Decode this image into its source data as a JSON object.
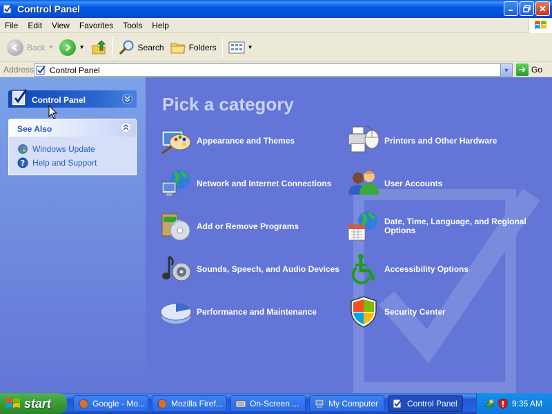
{
  "window": {
    "title": "Control Panel",
    "buttons": [
      "minimize",
      "maximize",
      "close"
    ]
  },
  "menubar": {
    "items": [
      "File",
      "Edit",
      "View",
      "Favorites",
      "Tools",
      "Help"
    ]
  },
  "toolbar": {
    "back_label": "Back",
    "search_label": "Search",
    "folders_label": "Folders"
  },
  "address": {
    "label": "Address",
    "value": "Control Panel",
    "go_label": "Go"
  },
  "leftpane": {
    "panel_title": "Control Panel",
    "see_also_title": "See Also",
    "links": [
      {
        "label": "Windows Update",
        "icon": "windows-update-icon"
      },
      {
        "label": "Help and Support",
        "icon": "help-icon"
      }
    ]
  },
  "main": {
    "heading": "Pick a category",
    "categories": [
      {
        "label": "Appearance and Themes",
        "icon": "appearance-themes-icon"
      },
      {
        "label": "Printers and Other Hardware",
        "icon": "printer-hardware-icon"
      },
      {
        "label": "Network and Internet Connections",
        "icon": "network-icon"
      },
      {
        "label": "User Accounts",
        "icon": "user-accounts-icon"
      },
      {
        "label": "Add or Remove Programs",
        "icon": "add-remove-programs-icon"
      },
      {
        "label": "Date, Time, Language, and Regional Options",
        "icon": "date-time-regional-icon"
      },
      {
        "label": "Sounds, Speech, and Audio Devices",
        "icon": "sounds-audio-icon"
      },
      {
        "label": "Accessibility Options",
        "icon": "accessibility-icon"
      },
      {
        "label": "Performance and Maintenance",
        "icon": "performance-icon"
      },
      {
        "label": "Security Center",
        "icon": "security-center-icon"
      }
    ]
  },
  "taskbar": {
    "start_label": "start",
    "tasks": [
      {
        "label": "Google - Mo...",
        "icon": "firefox-icon"
      },
      {
        "label": "Mozilla Firef...",
        "icon": "firefox-icon"
      },
      {
        "label": "On-Screen ...",
        "icon": "keyboard-icon"
      },
      {
        "label": "My Computer",
        "icon": "my-computer-icon"
      },
      {
        "label": "Control Panel",
        "icon": "control-panel-icon"
      }
    ],
    "clock": "9:35 AM"
  },
  "colors": {
    "titlebar": "#0458e3",
    "main_bg": "#6375d6",
    "left_pane_top": "#7ba2e7",
    "link": "#215dc6",
    "start_button": "#3c9f3c"
  }
}
